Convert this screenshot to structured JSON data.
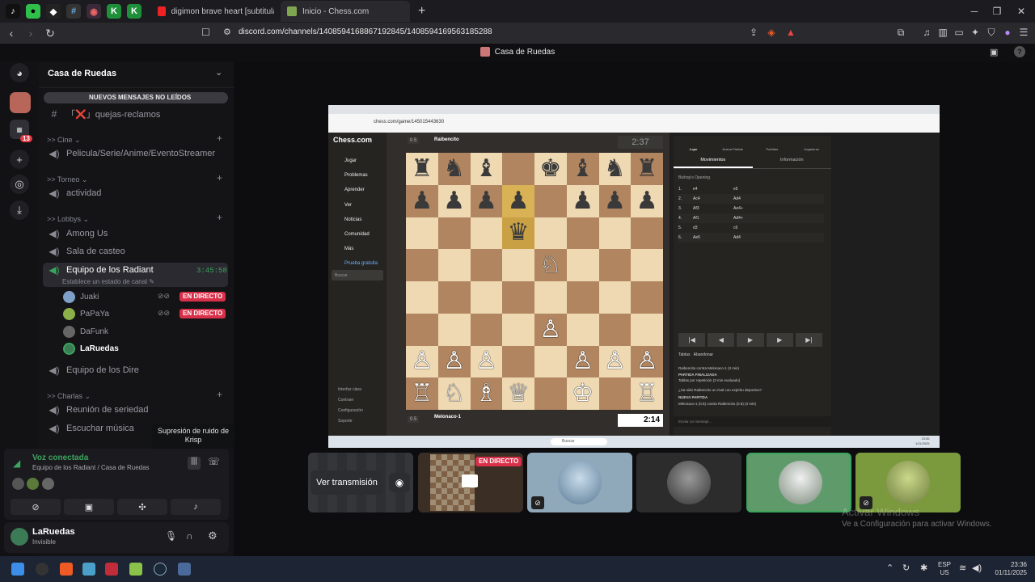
{
  "browser": {
    "tabs": [
      {
        "title": "digimon brave heart [subtitulado- es"
      },
      {
        "title": "Inicio - Chess.com"
      }
    ],
    "url": "discord.com/channels/1408594168867192845/1408594169563185288"
  },
  "discord": {
    "window_title": "Casa de Ruedas",
    "server_name": "Casa de Ruedas",
    "unread_banner": "NUEVOS MENSAJES NO LEÍDOS",
    "guild_badge": "13",
    "channels": {
      "quejas": "「❌」quejas-reclamos",
      "cine_cat": ">> Cine ⌄",
      "cine": "Pelicula/Serie/Anime/EventoStreamer",
      "torneo_cat": ">> Torneo ⌄",
      "actividad": "actividad",
      "lobbys_cat": ">> Lobbys ⌄",
      "among": "Among Us",
      "casteo": "Sala de casteo",
      "radiant": "Equipo de los Radiant",
      "radiant_time": "3:45:58",
      "radiant_status": "Establece un estado de canal ✎",
      "dire": "Equipo de los Dire",
      "charlas_cat": ">> Charlas ⌄",
      "reunion": "Reunión de seriedad",
      "musica": "Escuchar música"
    },
    "members": [
      {
        "name": "Juaki",
        "live": "EN DIRECTO"
      },
      {
        "name": "PaPaYa",
        "live": "EN DIRECTO"
      },
      {
        "name": "DaFunk",
        "live": ""
      },
      {
        "name": "LaRuedas",
        "live": ""
      }
    ],
    "tooltip": "Supresión de ruido de Krisp",
    "voice": {
      "status": "Voz conectada",
      "location": "Equipo de los Radiant / Casa de Ruedas"
    },
    "user": {
      "name": "LaRuedas",
      "status": "Invisible"
    },
    "stream_buttons": {
      "watch": "Ver transmisión",
      "live": "EN DIRECTO"
    },
    "watermark": {
      "title": "Activar Windows",
      "subtitle": "Ve a Configuración para activar Windows."
    }
  },
  "chess": {
    "url": "chess.com/game/145015443630",
    "logo": "Chess.com",
    "menu": [
      "Jugar",
      "Problemas",
      "Aprender",
      "Ver",
      "Noticias",
      "Comunidad",
      "Más",
      "Prueba gratuita"
    ],
    "search": "Buscar",
    "bottom_menu": [
      "Interfaz clara",
      "Contraer",
      "Configuración",
      "Soporte"
    ],
    "top_player": "Raibencito",
    "top_rating": "0.5",
    "top_clock": "2:37",
    "bottom_player": "Melonaco-1",
    "bottom_rating": "0.5",
    "bottom_clock": "2:14",
    "tabs": [
      "Jugar",
      "Nueva Partida",
      "Partidas",
      "Jugadores"
    ],
    "subtabs": [
      "Movimientos",
      "Información"
    ],
    "opening": "Bishop's Opening",
    "moves": [
      [
        "1.",
        "e4",
        "e5"
      ],
      [
        "2.",
        "Ac4",
        "Ad4"
      ],
      [
        "3.",
        "Af3",
        "Ae4+"
      ],
      [
        "4.",
        "Af1",
        "Ad4+"
      ],
      [
        "5.",
        "d3",
        "c6"
      ],
      [
        "6.",
        "Ae5",
        "Ad4"
      ]
    ],
    "actions": [
      "Tablas",
      "Abandonar"
    ],
    "chat": [
      "Raibencito contra Melonaco-1 (3 min)",
      "PARTIDA FINALIZADA",
      "Tablas por repetición (3 min evaluado)",
      "¿Ha sido Raibencito un rival con espíritu deportivo?",
      "NUEVA PARTIDA",
      "Melonaco-1 (0.5) contra Raibencito (0.5) (3 min)"
    ],
    "chat_placeholder": "Enviar un mensaje...",
    "win_search": "Buscar",
    "win_time": "23:36",
    "win_date": "1/11/2025",
    "board_rows": [
      "rnb.kbnr",
      "pppp.ppp",
      "...q....",
      "....N...",
      "........",
      "....P...",
      "PPP..PPP",
      "RNBQ.K.R"
    ]
  },
  "taskbar": {
    "lang": "ESP",
    "layout": "US",
    "time": "23:36",
    "date": "01/11/2025"
  }
}
